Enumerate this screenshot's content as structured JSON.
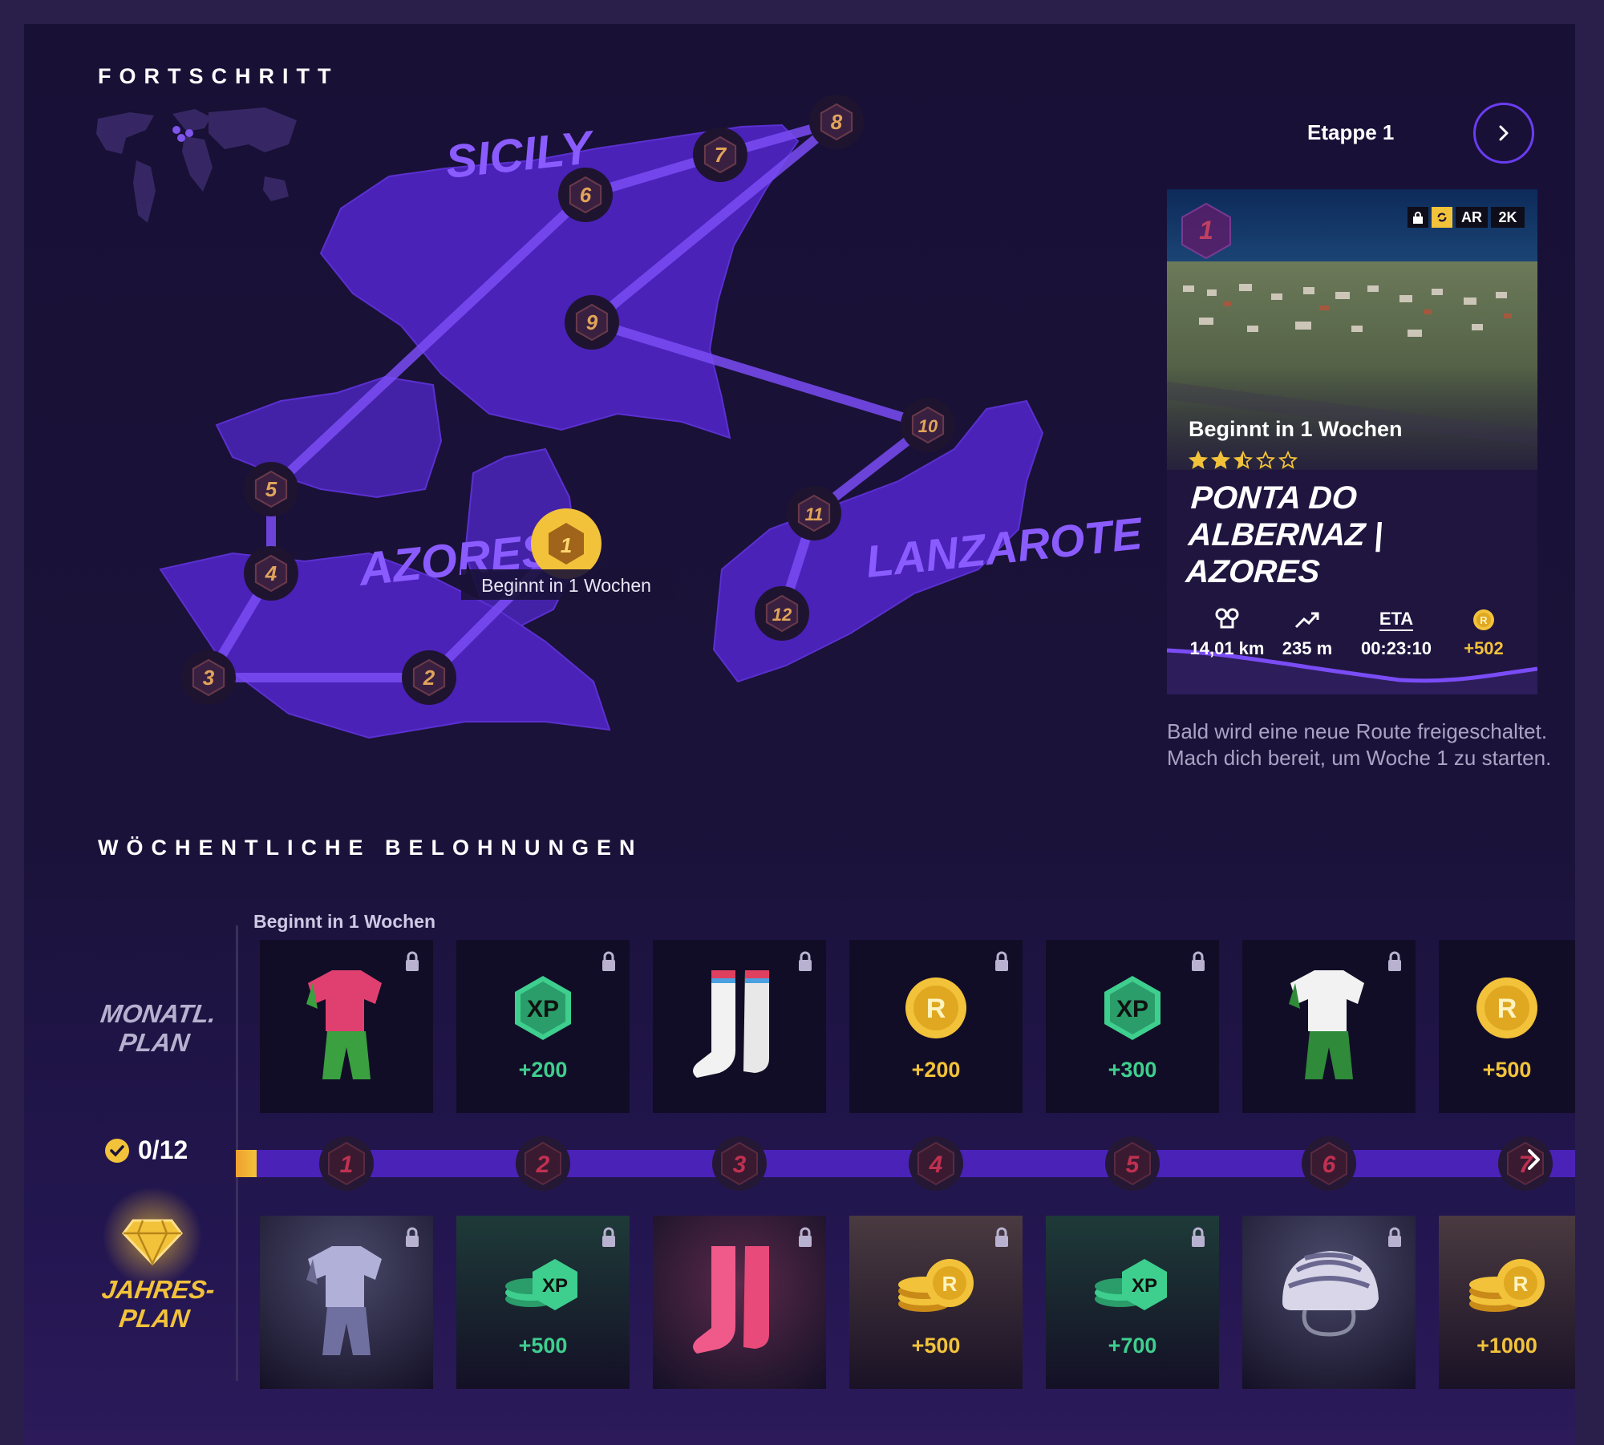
{
  "progress": {
    "title": "FORTSCHRITT",
    "regions": [
      "SICILY",
      "AZORES",
      "LANZAROTE"
    ],
    "stages": [
      "1",
      "2",
      "3",
      "4",
      "5",
      "6",
      "7",
      "8",
      "9",
      "10",
      "11",
      "12"
    ],
    "current_tooltip": "Beginnt in 1 Wochen"
  },
  "stage_nav": {
    "label": "Etappe 1"
  },
  "route_card": {
    "stage_number": "1",
    "badges": [
      "AR",
      "2K"
    ],
    "starts": "Beginnt in 1 Wochen",
    "rating": 2.5,
    "rating_max": 5,
    "name_line1": "PONTA DO ALBERNAZ |",
    "name_line2": "AZORES",
    "stats": {
      "distance": "14,01 km",
      "elevation": "235 m",
      "eta_label": "ETA",
      "eta": "00:23:10",
      "coins": "+502"
    },
    "description": "Bald wird eine neue Route freigeschaltet. Mach dich bereit, um Woche 1 zu starten."
  },
  "weekly": {
    "title": "WÖCHENTLICHE BELOHNUNGEN",
    "starts": "Beginnt in 1 Wochen",
    "monthly_label_1": "MONATL.",
    "monthly_label_2": "PLAN",
    "yearly_label_1": "JAHRES-",
    "yearly_label_2": "PLAN",
    "progress": "0/12",
    "weeks": [
      "1",
      "2",
      "3",
      "4",
      "5",
      "6",
      "7"
    ],
    "monthly_rewards": [
      {
        "type": "kit-pink-green",
        "amount": ""
      },
      {
        "type": "xp",
        "amount": "+200"
      },
      {
        "type": "socks-white",
        "amount": ""
      },
      {
        "type": "coin",
        "amount": "+200"
      },
      {
        "type": "xp",
        "amount": "+300"
      },
      {
        "type": "kit-white-green",
        "amount": ""
      },
      {
        "type": "coin",
        "amount": "+500"
      }
    ],
    "yearly_rewards": [
      {
        "type": "kit-grey",
        "amount": ""
      },
      {
        "type": "xp-stack",
        "amount": "+500"
      },
      {
        "type": "socks-pink",
        "amount": ""
      },
      {
        "type": "coin-stack",
        "amount": "+500"
      },
      {
        "type": "xp-stack",
        "amount": "+700"
      },
      {
        "type": "helmet",
        "amount": ""
      },
      {
        "type": "coin-stack",
        "amount": "+1000"
      }
    ]
  },
  "colors": {
    "accent": "#6a3cf0",
    "gold": "#f2c23a",
    "xp_green": "#3ecf8e",
    "map_fill": "#4a22b8",
    "route_line": "#7a4cf5"
  }
}
